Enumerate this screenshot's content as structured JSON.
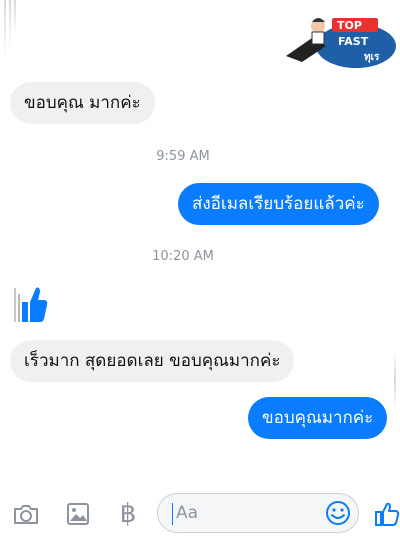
{
  "watermark": {
    "line1": "TOP",
    "line2": "FAST",
    "line3": "ทุเร"
  },
  "messages": [
    {
      "side": "in",
      "text": "ขอบคุณ มากค่ะ"
    },
    {
      "side": "ts",
      "text": "9:59 AM"
    },
    {
      "side": "out",
      "text": "ส่งอีเมลเรียบร้อยแล้วค่ะ"
    },
    {
      "side": "ts",
      "text": "10:20 AM"
    },
    {
      "side": "in",
      "text": "เร็วมาก สุดยอดเลย ขอบคุณมากค่ะ"
    },
    {
      "side": "out",
      "text": "ขอบคุณมากค่ะ"
    }
  ],
  "composer": {
    "placeholder": "Aa",
    "icons": [
      "camera-icon",
      "image-icon",
      "baht-icon",
      "emoji-icon",
      "like-icon"
    ],
    "baht_symbol": "฿"
  },
  "colors": {
    "accent": "#0a7cff",
    "incoming_bubble": "#f1f0f0",
    "muted": "#8d949e"
  }
}
